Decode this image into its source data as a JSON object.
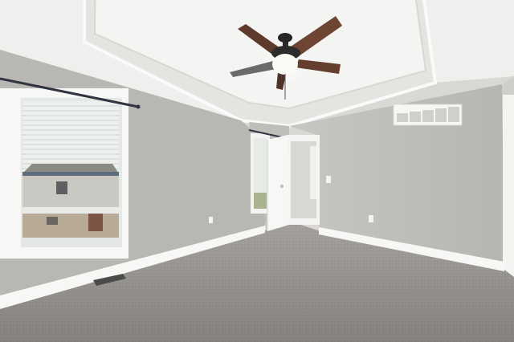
{
  "scene": {
    "kind": "empty-bedroom-interior",
    "objects": [
      "ceiling-fan",
      "tray-ceiling",
      "left-window-with-blinds",
      "open-door",
      "return-air-vent",
      "floor-vent",
      "carpet",
      "baseboards",
      "wall-outlets",
      "light-switch"
    ]
  },
  "colors": {
    "ceiling": "#f1f1ef",
    "tray_inner": "#e9e9e7",
    "wall_left": "#b9b9b6",
    "wall_back": "#c2c1be",
    "wall_right": "#bdbcb9",
    "carpet": "#8f8c88",
    "trim": "#f6f6f4",
    "fan_blade": "#6a4232",
    "fan_motor": "#2e2e2e",
    "window_glass": "#e6ece9"
  }
}
